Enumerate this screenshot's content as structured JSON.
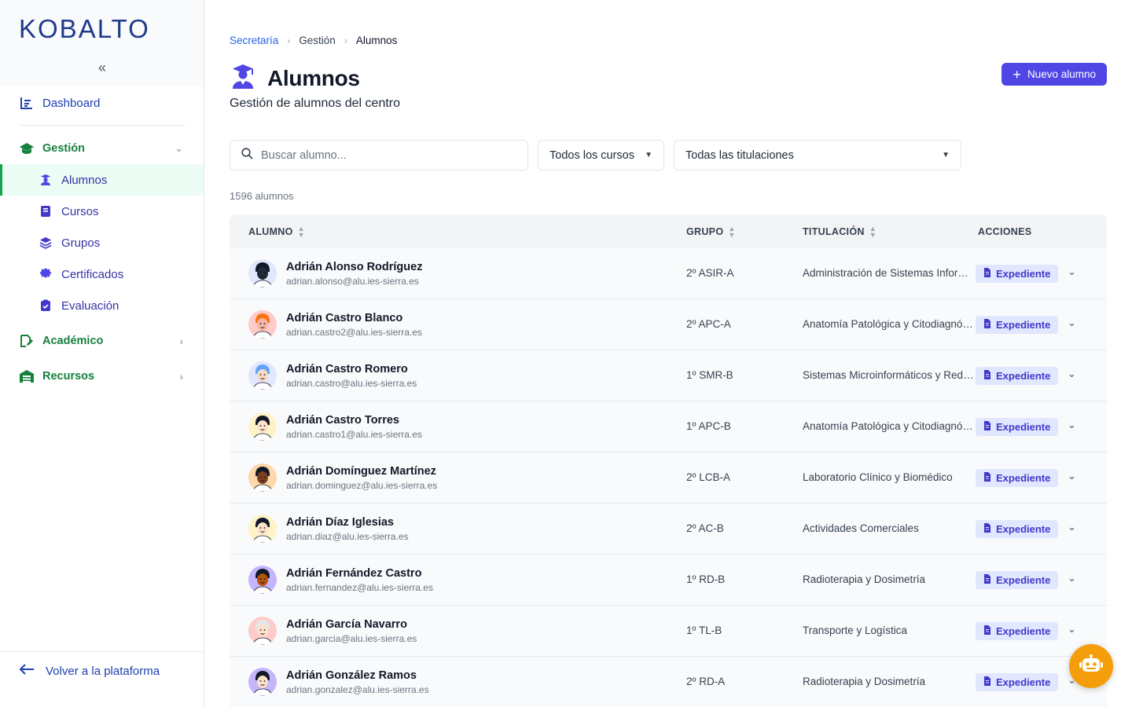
{
  "sidebar": {
    "logo": "KOBALTO",
    "collapse_label": "«",
    "dashboard": "Dashboard",
    "gestion": "Gestión",
    "alumnos": "Alumnos",
    "cursos": "Cursos",
    "grupos": "Grupos",
    "certificados": "Certificados",
    "evaluacion": "Evaluación",
    "academico": "Académico",
    "recursos": "Recursos",
    "back": "Volver a la plataforma"
  },
  "breadcrumb": [
    "Secretaría",
    "Gestión",
    "Alumnos"
  ],
  "page": {
    "title": "Alumnos",
    "subtitle": "Gestión de alumnos del centro",
    "new_button": "Nuevo alumno"
  },
  "filters": {
    "search_placeholder": "Buscar alumno...",
    "courses": "Todos los cursos",
    "titulaciones": "Todas las titulaciones"
  },
  "count": "1596 alumnos",
  "table": {
    "headers": {
      "alumno": "ALUMNO",
      "grupo": "GRUPO",
      "titulacion": "TITULACIÓN",
      "acciones": "ACCIONES"
    },
    "action_label": "Expediente",
    "rows": [
      {
        "name": "Adrián Alonso Rodríguez",
        "email": "adrian.alonso@alu.ies-sierra.es",
        "grupo": "2º ASIR-A",
        "titulacion": "Administración de Sistemas Informáticos en Red",
        "avatar_bg": "#e0e7ff",
        "skin": "#1f2937",
        "hair": "#111827"
      },
      {
        "name": "Adrián Castro Blanco",
        "email": "adrian.castro2@alu.ies-sierra.es",
        "grupo": "2º APC-A",
        "titulacion": "Anatomía Patológica y Citodiagnóstico",
        "avatar_bg": "#fecaca",
        "skin": "#f8b4a0",
        "hair": "#f97316"
      },
      {
        "name": "Adrián Castro Romero",
        "email": "adrian.castro@alu.ies-sierra.es",
        "grupo": "1º SMR-B",
        "titulacion": "Sistemas Microinformáticos y Redes",
        "avatar_bg": "#e0e7ff",
        "skin": "#fcd9c4",
        "hair": "#60a5fa"
      },
      {
        "name": "Adrián Castro Torres",
        "email": "adrian.castro1@alu.ies-sierra.es",
        "grupo": "1º APC-B",
        "titulacion": "Anatomía Patológica y Citodiagnóstico",
        "avatar_bg": "#fef3c7",
        "skin": "#fde0c8",
        "hair": "#111827"
      },
      {
        "name": "Adrián Domínguez Martínez",
        "email": "adrian.dominguez@alu.ies-sierra.es",
        "grupo": "2º LCB-A",
        "titulacion": "Laboratorio Clínico y Biomédico",
        "avatar_bg": "#fed7aa",
        "skin": "#7c3f1d",
        "hair": "#111827"
      },
      {
        "name": "Adrián Díaz Iglesias",
        "email": "adrian.diaz@alu.ies-sierra.es",
        "grupo": "2º AC-B",
        "titulacion": "Actividades Comerciales",
        "avatar_bg": "#fef3c7",
        "skin": "#fde0c8",
        "hair": "#111827"
      },
      {
        "name": "Adrián Fernández Castro",
        "email": "adrian.fernandez@alu.ies-sierra.es",
        "grupo": "1º RD-B",
        "titulacion": "Radioterapia y Dosimetría",
        "avatar_bg": "#c4b5fd",
        "skin": "#b45309",
        "hair": "#111827"
      },
      {
        "name": "Adrián García Navarro",
        "email": "adrian.garcia@alu.ies-sierra.es",
        "grupo": "1º TL-B",
        "titulacion": "Transporte y Logística",
        "avatar_bg": "#fecaca",
        "skin": "#fde0c8",
        "hair": "#e5e7eb"
      },
      {
        "name": "Adrián González Ramos",
        "email": "adrian.gonzalez@alu.ies-sierra.es",
        "grupo": "2º RD-A",
        "titulacion": "Radioterapia y Dosimetría",
        "avatar_bg": "#c4b5fd",
        "skin": "#fde0c8",
        "hair": "#111827"
      }
    ]
  },
  "colors": {
    "primary": "#4f46e5",
    "sidebar_green": "#15803d",
    "link_blue": "#2563eb",
    "bot": "#f59e0b"
  }
}
